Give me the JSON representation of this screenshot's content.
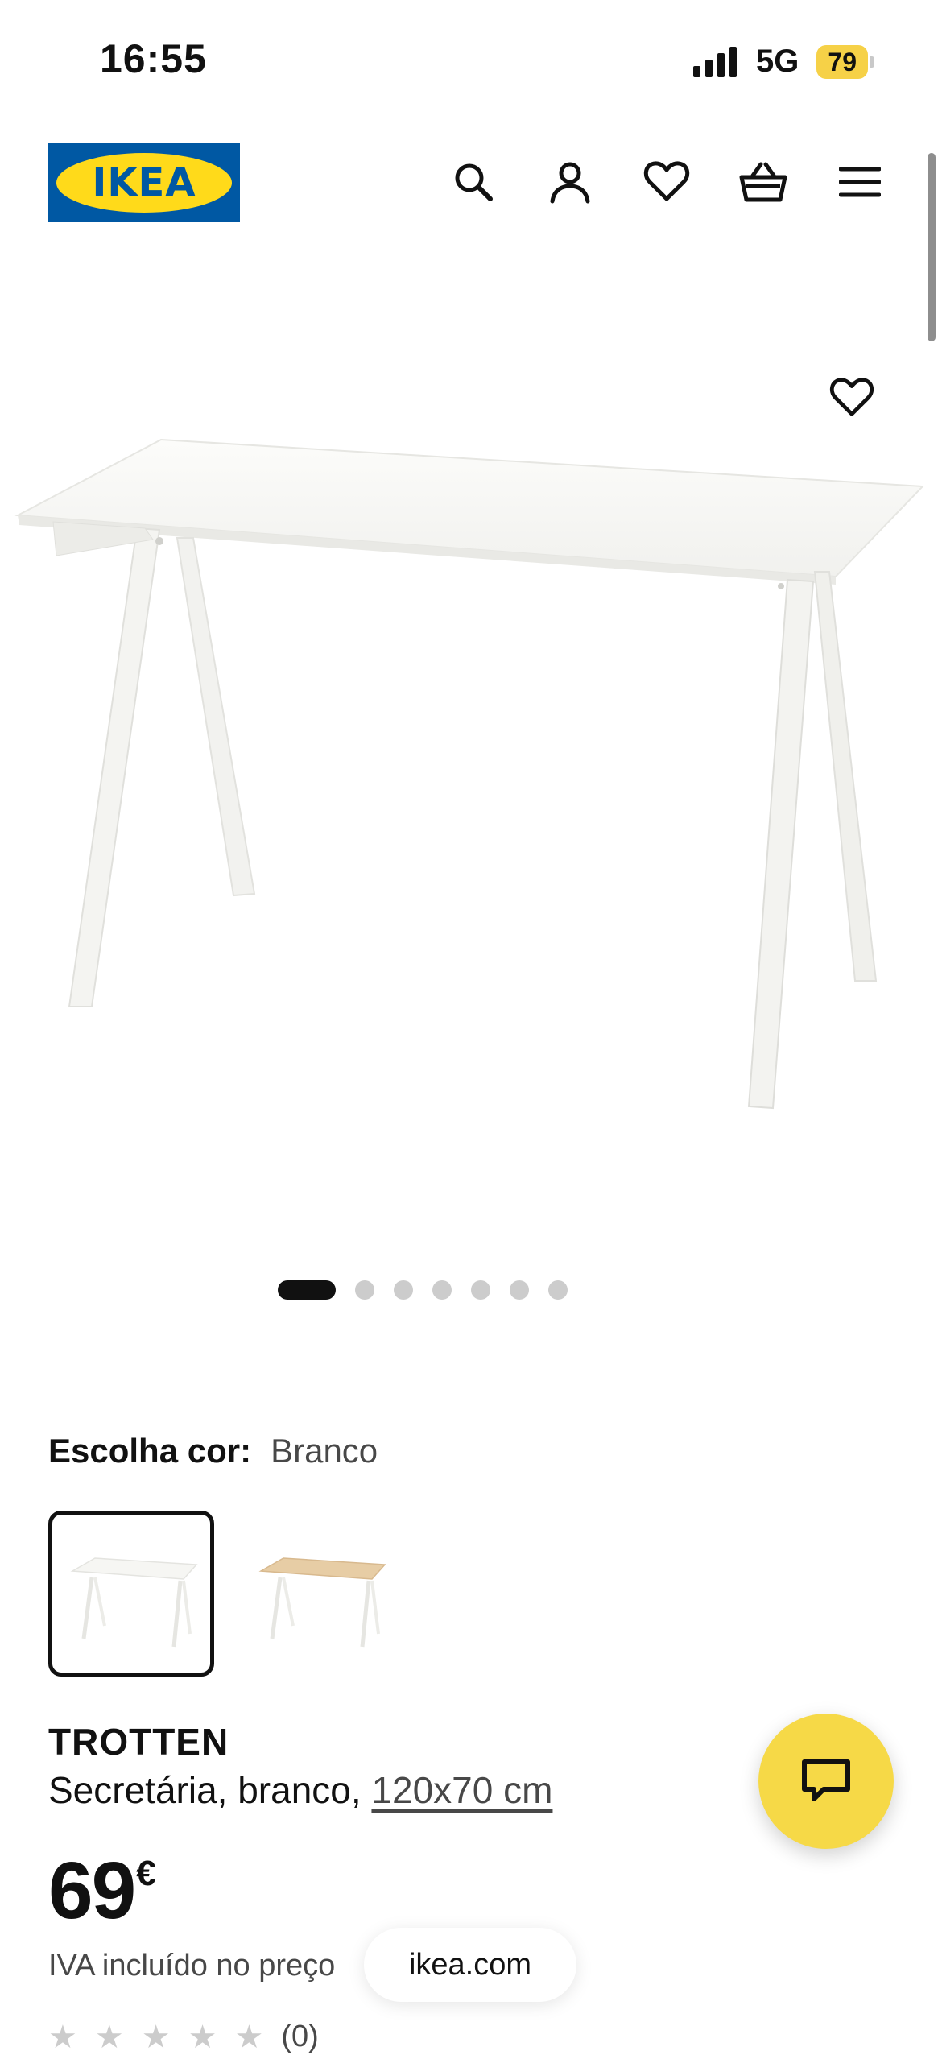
{
  "status_bar": {
    "time": "16:55",
    "network": "5G",
    "battery": "79"
  },
  "header": {
    "logo_text": "IKEA",
    "icons": [
      "search-icon",
      "account-icon",
      "heart-icon",
      "basket-icon",
      "menu-icon"
    ]
  },
  "gallery": {
    "slides_total": 7,
    "active_index": 0
  },
  "color_picker": {
    "label": "Escolha cor:",
    "selected": "Branco"
  },
  "product": {
    "name": "TROTTEN",
    "description": "Secretária, branco,",
    "dimensions": "120x70 cm",
    "price": "69",
    "currency": "€",
    "vat_note": "IVA incluído no preço",
    "rating_count": "(0)"
  },
  "browser": {
    "url": "ikea.com"
  },
  "colors": {
    "brand_blue": "#0058a3",
    "brand_yellow": "#ffda1a",
    "chat_yellow": "#f6d947"
  }
}
